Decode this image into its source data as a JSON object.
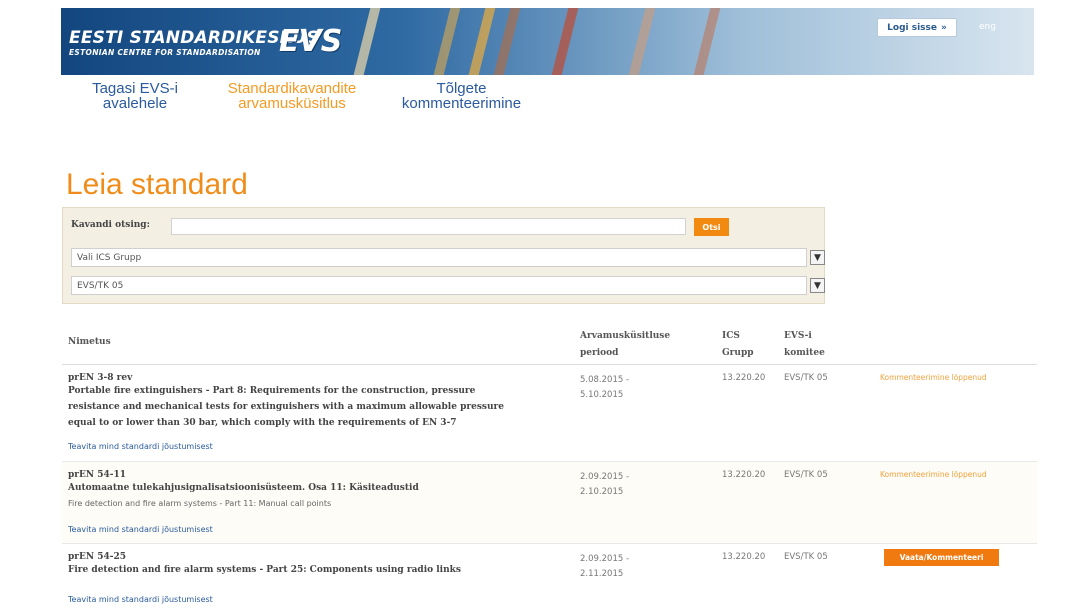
{
  "header": {
    "logo_title": "EESTI STANDARDIKESKUS",
    "logo_subtitle": "ESTONIAN CENTRE FOR STANDARDISATION",
    "logo_mark": "EVS",
    "login_label": "Logi sisse",
    "login_arrow": "»",
    "lang_label": "eng"
  },
  "nav": [
    {
      "line1": "Tagasi EVS-i",
      "line2": "avalehele"
    },
    {
      "line1": "Standardikavandite",
      "line2": "arvamusküsitlus"
    },
    {
      "line1": "Tõlgete",
      "line2": "kommenteerimine"
    }
  ],
  "page_title": "Leia standard",
  "search": {
    "label": "Kavandi otsing:",
    "value": "",
    "placeholder": "",
    "button_label": "Otsi",
    "ics_select": "Vali ICS Grupp",
    "committee_select": "EVS/TK 05",
    "arrow": "▼"
  },
  "table": {
    "headers": {
      "name": "Nimetus",
      "period_line1": "Arvamusküsitluse",
      "period_line2": "periood",
      "ics_line1": "ICS",
      "ics_line2": "Grupp",
      "committee_line1": "EVS-i",
      "committee_line2": "komitee"
    },
    "rows": [
      {
        "code": "prEN 3-8 rev",
        "title_lines": [
          "Portable fire extinguishers - Part 8: Requirements for the construction, pressure",
          "resistance and mechanical tests for extinguishers with a maximum allowable pressure",
          "equal to or lower than 30 bar, which comply with the requirements of EN 3-7"
        ],
        "subtitle": "",
        "period_start": "5.08.2015 -",
        "period_end": "5.10.2015",
        "ics": "13.220.20",
        "committee": "EVS/TK 05",
        "status": "Kommenteerimine lõppenud",
        "action": "",
        "notify": "Teavita mind standardi jõustumisest"
      },
      {
        "code": "prEN 54-11",
        "title_lines": [
          "Automaatne tulekahjusignalisatsioonisüsteem. Osa 11: Käsiteadustid"
        ],
        "subtitle": "Fire detection and fire alarm systems - Part 11: Manual call points",
        "period_start": "2.09.2015 -",
        "period_end": "2.10.2015",
        "ics": "13.220.20",
        "committee": "EVS/TK 05",
        "status": "Kommenteerimine lõppenud",
        "action": "",
        "notify": "Teavita mind standardi jõustumisest"
      },
      {
        "code": "prEN 54-25",
        "title_lines": [
          "Fire detection and fire alarm systems - Part 25: Components using radio links"
        ],
        "subtitle": "",
        "period_start": "2.09.2015 -",
        "period_end": "2.11.2015",
        "ics": "13.220.20",
        "committee": "EVS/TK 05",
        "status": "",
        "action": "Vaata/Kommenteeri",
        "notify": "Teavita mind standardi jõustumisest"
      }
    ]
  },
  "colors": {
    "accent_orange": "#f28a12",
    "nav_blue": "#2a5aa0",
    "nav_orange": "#f59a23",
    "banner_blue": "#13467e"
  }
}
